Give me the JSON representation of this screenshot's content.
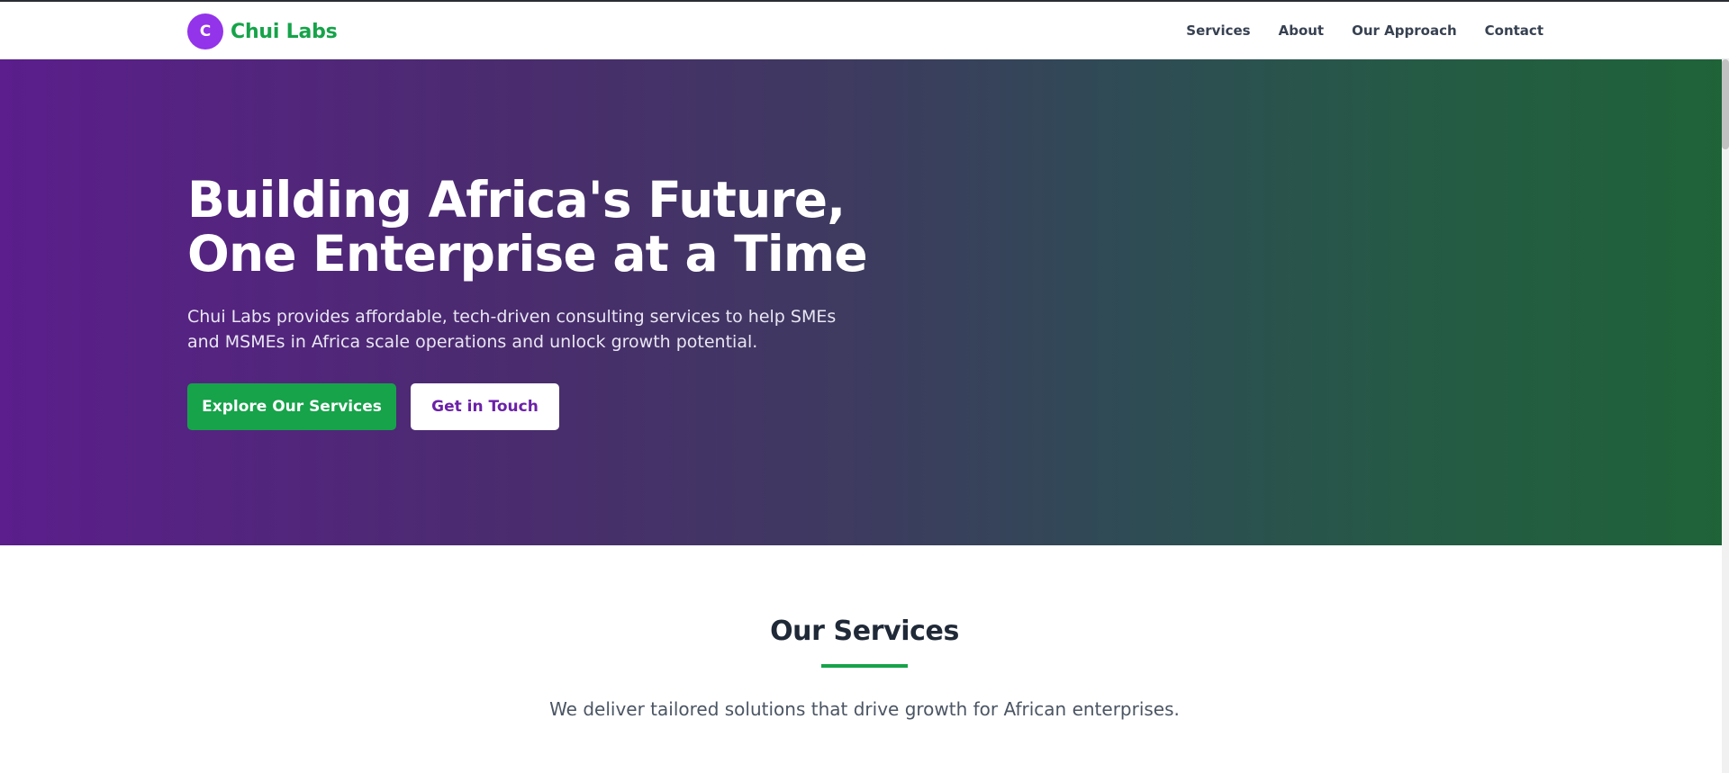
{
  "brand": {
    "logo_letter": "C",
    "name": "Chui Labs"
  },
  "nav": {
    "items": [
      "Services",
      "About",
      "Our Approach",
      "Contact"
    ]
  },
  "hero": {
    "title": "Building Africa's Future, One Enterprise at a Time",
    "subtitle": "Chui Labs provides affordable, tech-driven consulting services to help SMEs and MSMEs in Africa scale operations and unlock growth potential.",
    "primary_cta": "Explore Our Services",
    "secondary_cta": "Get in Touch"
  },
  "services": {
    "title": "Our Services",
    "subtitle": "We deliver tailored solutions that drive growth for African enterprises."
  },
  "colors": {
    "brand_green": "#16a34a",
    "brand_purple": "#9333ea",
    "hero_gradient_start": "#5b1e8c",
    "hero_gradient_end": "#1f6338"
  }
}
